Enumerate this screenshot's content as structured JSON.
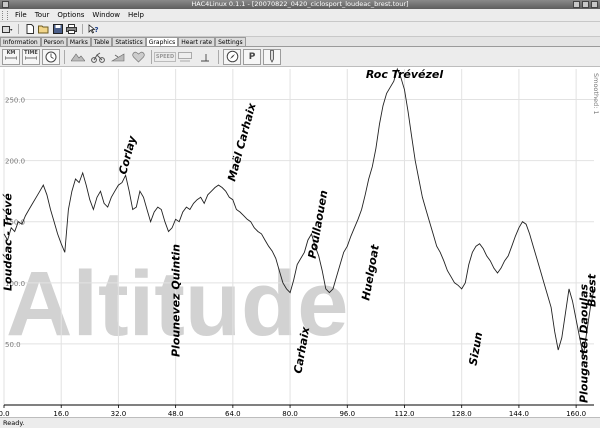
{
  "window": {
    "title": "HAC4Linux 0.1.1 - [20070822_0420_ciclosport_loudeac_brest.tour]"
  },
  "menu": {
    "items": [
      "File",
      "Tour",
      "Options",
      "Window",
      "Help"
    ]
  },
  "tabs": {
    "items": [
      "Information",
      "Person",
      "Marks",
      "Table",
      "Statistics",
      "Graphics",
      "Heart rate",
      "Settings"
    ],
    "active": "Graphics"
  },
  "graphics_toolbar": {
    "km_label": "KM",
    "time_label": "TIME",
    "speed_label": "SPEED",
    "p_label": "P"
  },
  "chart_data": {
    "type": "line",
    "watermark": "Altitude",
    "side_label": "Smoothed: 1",
    "xlim": [
      0,
      165
    ],
    "ylim": [
      0,
      275
    ],
    "x_ticks": [
      0,
      16,
      32,
      48,
      64,
      80,
      96,
      112,
      128,
      144,
      160
    ],
    "x_tick_labels": [
      "0.0",
      "16.0",
      "32.0",
      "48.0",
      "64.0",
      "80.0",
      "96.0",
      "112.0",
      "128.0",
      "144.0",
      "160.0"
    ],
    "y_ticks": [
      50,
      100,
      150,
      200,
      250
    ],
    "y_tick_labels": [
      "50.0",
      "100.0",
      "150.0",
      "200.0",
      "250.0"
    ],
    "grid": true,
    "series": [
      {
        "x": [
          0,
          1,
          2,
          3,
          4,
          5,
          6,
          7,
          8,
          9,
          10,
          11,
          12,
          13,
          14,
          15,
          16,
          17,
          18,
          19,
          20,
          21,
          22,
          23,
          24,
          25,
          26,
          27,
          28,
          29,
          30,
          31,
          32,
          33,
          34,
          35,
          36,
          37,
          38,
          39,
          40,
          41,
          42,
          43,
          44,
          45,
          46,
          47,
          48,
          49,
          50,
          51,
          52,
          53,
          54,
          55,
          56,
          57,
          58,
          59,
          60,
          61,
          62,
          63,
          64,
          65,
          66,
          67,
          68,
          69,
          70,
          71,
          72,
          73,
          74,
          75,
          76,
          77,
          78,
          79,
          80,
          81,
          82,
          83,
          84,
          85,
          86,
          87,
          88,
          89,
          90,
          91,
          92,
          93,
          94,
          95,
          96,
          97,
          98,
          99,
          100,
          101,
          102,
          103,
          104,
          105,
          106,
          107,
          108,
          109,
          110,
          111,
          112,
          113,
          114,
          115,
          116,
          117,
          118,
          119,
          120,
          121,
          122,
          123,
          124,
          125,
          126,
          127,
          128,
          129,
          130,
          131,
          132,
          133,
          134,
          135,
          136,
          137,
          138,
          139,
          140,
          141,
          142,
          143,
          144,
          145,
          146,
          147,
          148,
          149,
          150,
          151,
          152,
          153,
          154,
          155,
          156,
          157,
          158,
          159,
          160,
          161,
          162,
          163,
          164,
          165
        ],
        "values": [
          140,
          135,
          145,
          142,
          150,
          148,
          155,
          160,
          165,
          170,
          175,
          180,
          172,
          160,
          150,
          140,
          132,
          125,
          160,
          175,
          185,
          182,
          190,
          180,
          168,
          160,
          170,
          175,
          165,
          162,
          170,
          175,
          180,
          182,
          188,
          175,
          160,
          162,
          175,
          170,
          160,
          150,
          158,
          162,
          160,
          150,
          142,
          145,
          152,
          150,
          158,
          162,
          160,
          165,
          168,
          170,
          165,
          172,
          175,
          178,
          180,
          178,
          175,
          170,
          168,
          160,
          158,
          155,
          152,
          150,
          145,
          142,
          140,
          135,
          130,
          126,
          120,
          110,
          100,
          95,
          92,
          102,
          115,
          120,
          125,
          135,
          140,
          130,
          122,
          110,
          95,
          92,
          95,
          105,
          115,
          125,
          130,
          138,
          145,
          152,
          160,
          172,
          185,
          195,
          210,
          230,
          245,
          255,
          260,
          265,
          275,
          268,
          258,
          240,
          220,
          200,
          185,
          170,
          160,
          150,
          140,
          130,
          125,
          118,
          110,
          105,
          100,
          98,
          95,
          100,
          115,
          125,
          130,
          132,
          128,
          122,
          118,
          112,
          108,
          112,
          118,
          122,
          130,
          138,
          145,
          150,
          148,
          140,
          130,
          120,
          110,
          100,
          90,
          80,
          60,
          45,
          55,
          75,
          95,
          85,
          70,
          55,
          40,
          60,
          80,
          95
        ]
      }
    ],
    "annotations": [
      {
        "text": "Loudéac - Trévé",
        "x": 1
      },
      {
        "text": "Corlay",
        "x": 33
      },
      {
        "text": "Plounevez Quintin",
        "x": 48
      },
      {
        "text": "Maël Carhaix",
        "x": 64
      },
      {
        "text": "Poullaouen",
        "x": 86
      },
      {
        "text": "Carhaix",
        "x": 82
      },
      {
        "text": "Huelgoat",
        "x": 101
      },
      {
        "text": "Roc Trévézel",
        "x": 112
      },
      {
        "text": "Sizun",
        "x": 131
      },
      {
        "text": "Plougastel Daoulas",
        "x": 162
      },
      {
        "text": "Brest",
        "x": 166
      }
    ]
  },
  "status": {
    "text": "Ready."
  }
}
